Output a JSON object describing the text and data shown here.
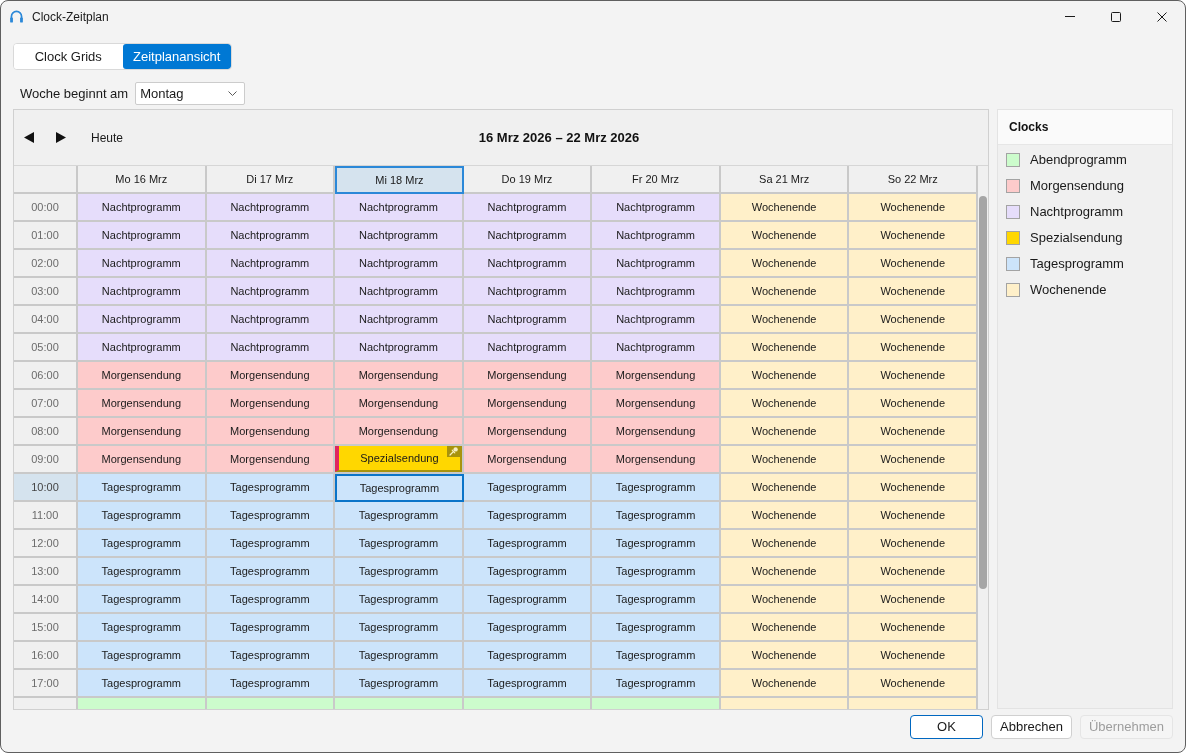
{
  "window": {
    "title": "Clock-Zeitplan"
  },
  "view_tabs": [
    {
      "label": "Clock Grids",
      "selected": false
    },
    {
      "label": "Zeitplanansicht",
      "selected": true
    }
  ],
  "week_start": {
    "label": "Woche beginnt am",
    "value": "Montag"
  },
  "calendar": {
    "today_button": "Heute",
    "range_title": "16 Mrz 2026 – 22 Mrz 2026",
    "days": [
      {
        "label": "Mo 16 Mrz",
        "selected": false
      },
      {
        "label": "Di 17 Mrz",
        "selected": false
      },
      {
        "label": "Mi 18 Mrz",
        "selected": true
      },
      {
        "label": "Do 19 Mrz",
        "selected": false
      },
      {
        "label": "Fr 20 Mrz",
        "selected": false
      },
      {
        "label": "Sa 21 Mrz",
        "selected": false
      },
      {
        "label": "So 22 Mrz",
        "selected": false
      }
    ],
    "rows": [
      {
        "time": "00:00",
        "selected": false,
        "cells": [
          {
            "label": "Nachtprogramm",
            "color": "#e6ddfb",
            "kind": "clock"
          },
          {
            "label": "Nachtprogramm",
            "color": "#e6ddfb",
            "kind": "clock"
          },
          {
            "label": "Nachtprogramm",
            "color": "#e6ddfb",
            "kind": "clock"
          },
          {
            "label": "Nachtprogramm",
            "color": "#e6ddfb",
            "kind": "clock"
          },
          {
            "label": "Nachtprogramm",
            "color": "#e6ddfb",
            "kind": "clock"
          },
          {
            "label": "Wochenende",
            "color": "#fff0c9",
            "kind": "clock"
          },
          {
            "label": "Wochenende",
            "color": "#fff0c9",
            "kind": "clock"
          }
        ]
      },
      {
        "time": "01:00",
        "selected": false,
        "cells": [
          {
            "label": "Nachtprogramm",
            "color": "#e6ddfb",
            "kind": "clock"
          },
          {
            "label": "Nachtprogramm",
            "color": "#e6ddfb",
            "kind": "clock"
          },
          {
            "label": "Nachtprogramm",
            "color": "#e6ddfb",
            "kind": "clock"
          },
          {
            "label": "Nachtprogramm",
            "color": "#e6ddfb",
            "kind": "clock"
          },
          {
            "label": "Nachtprogramm",
            "color": "#e6ddfb",
            "kind": "clock"
          },
          {
            "label": "Wochenende",
            "color": "#fff0c9",
            "kind": "clock"
          },
          {
            "label": "Wochenende",
            "color": "#fff0c9",
            "kind": "clock"
          }
        ]
      },
      {
        "time": "02:00",
        "selected": false,
        "cells": [
          {
            "label": "Nachtprogramm",
            "color": "#e6ddfb",
            "kind": "clock"
          },
          {
            "label": "Nachtprogramm",
            "color": "#e6ddfb",
            "kind": "clock"
          },
          {
            "label": "Nachtprogramm",
            "color": "#e6ddfb",
            "kind": "clock"
          },
          {
            "label": "Nachtprogramm",
            "color": "#e6ddfb",
            "kind": "clock"
          },
          {
            "label": "Nachtprogramm",
            "color": "#e6ddfb",
            "kind": "clock"
          },
          {
            "label": "Wochenende",
            "color": "#fff0c9",
            "kind": "clock"
          },
          {
            "label": "Wochenende",
            "color": "#fff0c9",
            "kind": "clock"
          }
        ]
      },
      {
        "time": "03:00",
        "selected": false,
        "cells": [
          {
            "label": "Nachtprogramm",
            "color": "#e6ddfb",
            "kind": "clock"
          },
          {
            "label": "Nachtprogramm",
            "color": "#e6ddfb",
            "kind": "clock"
          },
          {
            "label": "Nachtprogramm",
            "color": "#e6ddfb",
            "kind": "clock"
          },
          {
            "label": "Nachtprogramm",
            "color": "#e6ddfb",
            "kind": "clock"
          },
          {
            "label": "Nachtprogramm",
            "color": "#e6ddfb",
            "kind": "clock"
          },
          {
            "label": "Wochenende",
            "color": "#fff0c9",
            "kind": "clock"
          },
          {
            "label": "Wochenende",
            "color": "#fff0c9",
            "kind": "clock"
          }
        ]
      },
      {
        "time": "04:00",
        "selected": false,
        "cells": [
          {
            "label": "Nachtprogramm",
            "color": "#e6ddfb",
            "kind": "clock"
          },
          {
            "label": "Nachtprogramm",
            "color": "#e6ddfb",
            "kind": "clock"
          },
          {
            "label": "Nachtprogramm",
            "color": "#e6ddfb",
            "kind": "clock"
          },
          {
            "label": "Nachtprogramm",
            "color": "#e6ddfb",
            "kind": "clock"
          },
          {
            "label": "Nachtprogramm",
            "color": "#e6ddfb",
            "kind": "clock"
          },
          {
            "label": "Wochenende",
            "color": "#fff0c9",
            "kind": "clock"
          },
          {
            "label": "Wochenende",
            "color": "#fff0c9",
            "kind": "clock"
          }
        ]
      },
      {
        "time": "05:00",
        "selected": false,
        "cells": [
          {
            "label": "Nachtprogramm",
            "color": "#e6ddfb",
            "kind": "clock"
          },
          {
            "label": "Nachtprogramm",
            "color": "#e6ddfb",
            "kind": "clock"
          },
          {
            "label": "Nachtprogramm",
            "color": "#e6ddfb",
            "kind": "clock"
          },
          {
            "label": "Nachtprogramm",
            "color": "#e6ddfb",
            "kind": "clock"
          },
          {
            "label": "Nachtprogramm",
            "color": "#e6ddfb",
            "kind": "clock"
          },
          {
            "label": "Wochenende",
            "color": "#fff0c9",
            "kind": "clock"
          },
          {
            "label": "Wochenende",
            "color": "#fff0c9",
            "kind": "clock"
          }
        ]
      },
      {
        "time": "06:00",
        "selected": false,
        "cells": [
          {
            "label": "Morgensendung",
            "color": "#fdcbcb",
            "kind": "clock"
          },
          {
            "label": "Morgensendung",
            "color": "#fdcbcb",
            "kind": "clock"
          },
          {
            "label": "Morgensendung",
            "color": "#fdcbcb",
            "kind": "clock"
          },
          {
            "label": "Morgensendung",
            "color": "#fdcbcb",
            "kind": "clock"
          },
          {
            "label": "Morgensendung",
            "color": "#fdcbcb",
            "kind": "clock"
          },
          {
            "label": "Wochenende",
            "color": "#fff0c9",
            "kind": "clock"
          },
          {
            "label": "Wochenende",
            "color": "#fff0c9",
            "kind": "clock"
          }
        ]
      },
      {
        "time": "07:00",
        "selected": false,
        "cells": [
          {
            "label": "Morgensendung",
            "color": "#fdcbcb",
            "kind": "clock"
          },
          {
            "label": "Morgensendung",
            "color": "#fdcbcb",
            "kind": "clock"
          },
          {
            "label": "Morgensendung",
            "color": "#fdcbcb",
            "kind": "clock"
          },
          {
            "label": "Morgensendung",
            "color": "#fdcbcb",
            "kind": "clock"
          },
          {
            "label": "Morgensendung",
            "color": "#fdcbcb",
            "kind": "clock"
          },
          {
            "label": "Wochenende",
            "color": "#fff0c9",
            "kind": "clock"
          },
          {
            "label": "Wochenende",
            "color": "#fff0c9",
            "kind": "clock"
          }
        ]
      },
      {
        "time": "08:00",
        "selected": false,
        "cells": [
          {
            "label": "Morgensendung",
            "color": "#fdcbcb",
            "kind": "clock"
          },
          {
            "label": "Morgensendung",
            "color": "#fdcbcb",
            "kind": "clock"
          },
          {
            "label": "Morgensendung",
            "color": "#fdcbcb",
            "kind": "clock"
          },
          {
            "label": "Morgensendung",
            "color": "#fdcbcb",
            "kind": "clock"
          },
          {
            "label": "Morgensendung",
            "color": "#fdcbcb",
            "kind": "clock"
          },
          {
            "label": "Wochenende",
            "color": "#fff0c9",
            "kind": "clock"
          },
          {
            "label": "Wochenende",
            "color": "#fff0c9",
            "kind": "clock"
          }
        ]
      },
      {
        "time": "09:00",
        "selected": false,
        "cells": [
          {
            "label": "Morgensendung",
            "color": "#fdcbcb",
            "kind": "clock"
          },
          {
            "label": "Morgensendung",
            "color": "#fdcbcb",
            "kind": "clock"
          },
          {
            "label": "Spezialsendung",
            "color": "#ffd700",
            "kind": "override"
          },
          {
            "label": "Morgensendung",
            "color": "#fdcbcb",
            "kind": "clock"
          },
          {
            "label": "Morgensendung",
            "color": "#fdcbcb",
            "kind": "clock"
          },
          {
            "label": "Wochenende",
            "color": "#fff0c9",
            "kind": "clock"
          },
          {
            "label": "Wochenende",
            "color": "#fff0c9",
            "kind": "clock"
          }
        ]
      },
      {
        "time": "10:00",
        "selected": true,
        "cells": [
          {
            "label": "Tagesprogramm",
            "color": "#cce4fb",
            "kind": "clock"
          },
          {
            "label": "Tagesprogramm",
            "color": "#cce4fb",
            "kind": "clock"
          },
          {
            "label": "Tagesprogramm",
            "color": "#cce4fb",
            "kind": "clock"
          },
          {
            "label": "Tagesprogramm",
            "color": "#cce4fb",
            "kind": "clock"
          },
          {
            "label": "Tagesprogramm",
            "color": "#cce4fb",
            "kind": "clock"
          },
          {
            "label": "Wochenende",
            "color": "#fff0c9",
            "kind": "clock"
          },
          {
            "label": "Wochenende",
            "color": "#fff0c9",
            "kind": "clock"
          }
        ]
      },
      {
        "time": "11:00",
        "selected": false,
        "cells": [
          {
            "label": "Tagesprogramm",
            "color": "#cce4fb",
            "kind": "clock"
          },
          {
            "label": "Tagesprogramm",
            "color": "#cce4fb",
            "kind": "clock"
          },
          {
            "label": "Tagesprogramm",
            "color": "#cce4fb",
            "kind": "clock"
          },
          {
            "label": "Tagesprogramm",
            "color": "#cce4fb",
            "kind": "clock"
          },
          {
            "label": "Tagesprogramm",
            "color": "#cce4fb",
            "kind": "clock"
          },
          {
            "label": "Wochenende",
            "color": "#fff0c9",
            "kind": "clock"
          },
          {
            "label": "Wochenende",
            "color": "#fff0c9",
            "kind": "clock"
          }
        ]
      },
      {
        "time": "12:00",
        "selected": false,
        "cells": [
          {
            "label": "Tagesprogramm",
            "color": "#cce4fb",
            "kind": "clock"
          },
          {
            "label": "Tagesprogramm",
            "color": "#cce4fb",
            "kind": "clock"
          },
          {
            "label": "Tagesprogramm",
            "color": "#cce4fb",
            "kind": "clock"
          },
          {
            "label": "Tagesprogramm",
            "color": "#cce4fb",
            "kind": "clock"
          },
          {
            "label": "Tagesprogramm",
            "color": "#cce4fb",
            "kind": "clock"
          },
          {
            "label": "Wochenende",
            "color": "#fff0c9",
            "kind": "clock"
          },
          {
            "label": "Wochenende",
            "color": "#fff0c9",
            "kind": "clock"
          }
        ]
      },
      {
        "time": "13:00",
        "selected": false,
        "cells": [
          {
            "label": "Tagesprogramm",
            "color": "#cce4fb",
            "kind": "clock"
          },
          {
            "label": "Tagesprogramm",
            "color": "#cce4fb",
            "kind": "clock"
          },
          {
            "label": "Tagesprogramm",
            "color": "#cce4fb",
            "kind": "clock"
          },
          {
            "label": "Tagesprogramm",
            "color": "#cce4fb",
            "kind": "clock"
          },
          {
            "label": "Tagesprogramm",
            "color": "#cce4fb",
            "kind": "clock"
          },
          {
            "label": "Wochenende",
            "color": "#fff0c9",
            "kind": "clock"
          },
          {
            "label": "Wochenende",
            "color": "#fff0c9",
            "kind": "clock"
          }
        ]
      },
      {
        "time": "14:00",
        "selected": false,
        "cells": [
          {
            "label": "Tagesprogramm",
            "color": "#cce4fb",
            "kind": "clock"
          },
          {
            "label": "Tagesprogramm",
            "color": "#cce4fb",
            "kind": "clock"
          },
          {
            "label": "Tagesprogramm",
            "color": "#cce4fb",
            "kind": "clock"
          },
          {
            "label": "Tagesprogramm",
            "color": "#cce4fb",
            "kind": "clock"
          },
          {
            "label": "Tagesprogramm",
            "color": "#cce4fb",
            "kind": "clock"
          },
          {
            "label": "Wochenende",
            "color": "#fff0c9",
            "kind": "clock"
          },
          {
            "label": "Wochenende",
            "color": "#fff0c9",
            "kind": "clock"
          }
        ]
      },
      {
        "time": "15:00",
        "selected": false,
        "cells": [
          {
            "label": "Tagesprogramm",
            "color": "#cce4fb",
            "kind": "clock"
          },
          {
            "label": "Tagesprogramm",
            "color": "#cce4fb",
            "kind": "clock"
          },
          {
            "label": "Tagesprogramm",
            "color": "#cce4fb",
            "kind": "clock"
          },
          {
            "label": "Tagesprogramm",
            "color": "#cce4fb",
            "kind": "clock"
          },
          {
            "label": "Tagesprogramm",
            "color": "#cce4fb",
            "kind": "clock"
          },
          {
            "label": "Wochenende",
            "color": "#fff0c9",
            "kind": "clock"
          },
          {
            "label": "Wochenende",
            "color": "#fff0c9",
            "kind": "clock"
          }
        ]
      },
      {
        "time": "16:00",
        "selected": false,
        "cells": [
          {
            "label": "Tagesprogramm",
            "color": "#cce4fb",
            "kind": "clock"
          },
          {
            "label": "Tagesprogramm",
            "color": "#cce4fb",
            "kind": "clock"
          },
          {
            "label": "Tagesprogramm",
            "color": "#cce4fb",
            "kind": "clock"
          },
          {
            "label": "Tagesprogramm",
            "color": "#cce4fb",
            "kind": "clock"
          },
          {
            "label": "Tagesprogramm",
            "color": "#cce4fb",
            "kind": "clock"
          },
          {
            "label": "Wochenende",
            "color": "#fff0c9",
            "kind": "clock"
          },
          {
            "label": "Wochenende",
            "color": "#fff0c9",
            "kind": "clock"
          }
        ]
      },
      {
        "time": "17:00",
        "selected": false,
        "cells": [
          {
            "label": "Tagesprogramm",
            "color": "#cce4fb",
            "kind": "clock"
          },
          {
            "label": "Tagesprogramm",
            "color": "#cce4fb",
            "kind": "clock"
          },
          {
            "label": "Tagesprogramm",
            "color": "#cce4fb",
            "kind": "clock"
          },
          {
            "label": "Tagesprogramm",
            "color": "#cce4fb",
            "kind": "clock"
          },
          {
            "label": "Tagesprogramm",
            "color": "#cce4fb",
            "kind": "clock"
          },
          {
            "label": "Wochenende",
            "color": "#fff0c9",
            "kind": "clock"
          },
          {
            "label": "Wochenende",
            "color": "#fff0c9",
            "kind": "clock"
          }
        ]
      }
    ],
    "partial_row": {
      "cells": [
        {
          "color": "#ccfccc"
        },
        {
          "color": "#ccfccc"
        },
        {
          "color": "#ccfccc"
        },
        {
          "color": "#ccfccc"
        },
        {
          "color": "#ccfccc"
        },
        {
          "color": "#fff0c9"
        },
        {
          "color": "#fff0c9"
        }
      ]
    }
  },
  "clocks_panel": {
    "title": "Clocks",
    "items": [
      {
        "name": "Abendprogramm",
        "color": "#ccfccc"
      },
      {
        "name": "Morgensendung",
        "color": "#fdcbcb"
      },
      {
        "name": "Nachtprogramm",
        "color": "#e6ddfb"
      },
      {
        "name": "Spezialsendung",
        "color": "#ffd700"
      },
      {
        "name": "Tagesprogramm",
        "color": "#cce4fb"
      },
      {
        "name": "Wochenende",
        "color": "#fff0c9"
      }
    ]
  },
  "buttons": [
    {
      "label": "OK",
      "kind": "primary",
      "disabled": false
    },
    {
      "label": "Abbrechen",
      "kind": "default",
      "disabled": false
    },
    {
      "label": "Übernehmen",
      "kind": "default",
      "disabled": true
    }
  ]
}
